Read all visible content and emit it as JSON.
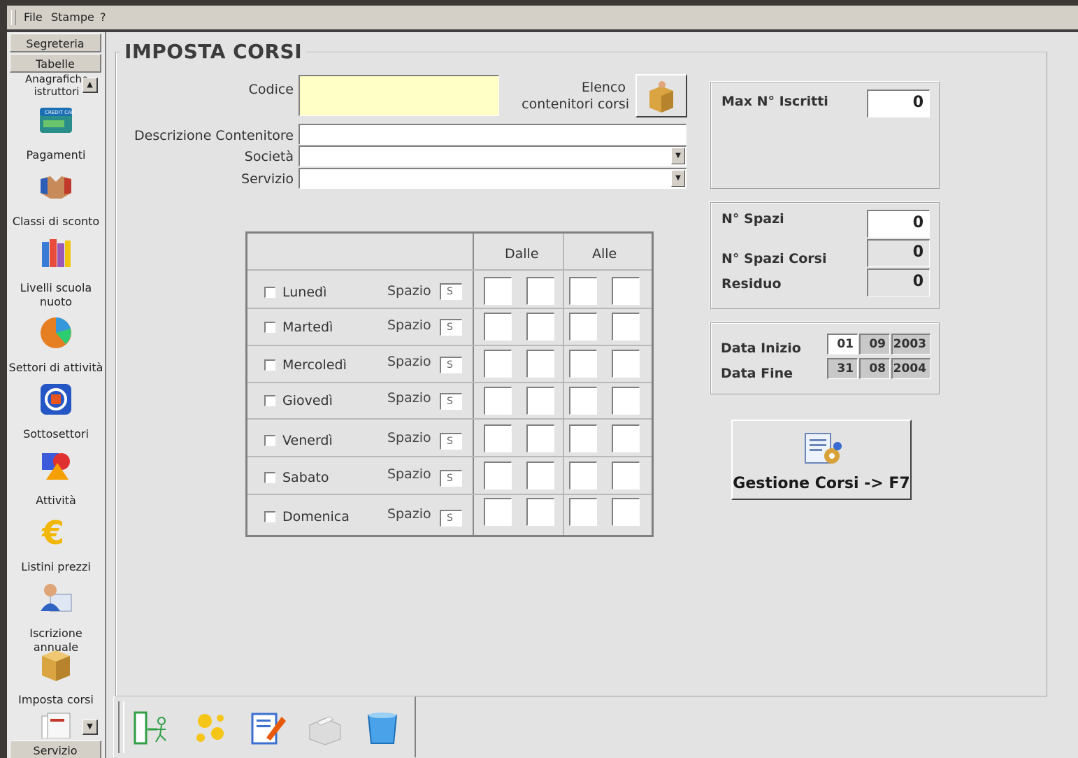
{
  "menubar": {
    "file": "File",
    "stampe": "Stampe",
    "help": "?"
  },
  "sidebar": {
    "segreteria": "Segreteria",
    "tabelle": "Tabelle",
    "servizio": "Servizio",
    "partial_item": "Anagrafiche istruttori",
    "items": [
      {
        "label": "Pagamenti",
        "icon": "credit-card-icon"
      },
      {
        "label": "Classi di sconto",
        "icon": "handshake-icon"
      },
      {
        "label": "Livelli scuola nuoto",
        "icon": "books-icon"
      },
      {
        "label": "Settori di attività",
        "icon": "pie-chart-icon"
      },
      {
        "label": "Sottosettori",
        "icon": "refresh-box-icon"
      },
      {
        "label": "Attività",
        "icon": "shapes-icon"
      },
      {
        "label": "Listini prezzi",
        "icon": "euro-icon"
      },
      {
        "label": "Iscrizione annuale",
        "icon": "user-card-icon"
      },
      {
        "label": "Imposta corsi",
        "icon": "box-icon"
      },
      {
        "label": "",
        "icon": "documents-icon"
      }
    ]
  },
  "form": {
    "title": "IMPOSTA CORSI",
    "codice_label": "Codice",
    "codice_value": "",
    "elenco_label_1": "Elenco",
    "elenco_label_2": "contenitori corsi",
    "descrizione_label": "Descrizione Contenitore",
    "societa_label": "Società",
    "servizio_label": "Servizio"
  },
  "schedule": {
    "dalle": "Dalle",
    "alle": "Alle",
    "spazio_label": "Spazio",
    "days": [
      {
        "name": "Lunedì",
        "spazio": "S"
      },
      {
        "name": "Martedì",
        "spazio": "S"
      },
      {
        "name": "Mercoledì",
        "spazio": "S"
      },
      {
        "name": "Giovedì",
        "spazio": "S"
      },
      {
        "name": "Venerdì",
        "spazio": "S"
      },
      {
        "name": "Sabato",
        "spazio": "S"
      },
      {
        "name": "Domenica",
        "spazio": "S"
      }
    ]
  },
  "iscritti": {
    "label": "Max N° Iscritti",
    "value": "0"
  },
  "spazi": {
    "spazi_label": "N° Spazi",
    "spazi_value": "0",
    "corsi_label": "N° Spazi Corsi",
    "corsi_value": "0",
    "residuo_label": "Residuo",
    "residuo_value": "0"
  },
  "dates": {
    "inizio_label": "Data Inizio",
    "inizio": [
      "01",
      "09",
      "2003"
    ],
    "fine_label": "Data Fine",
    "fine": [
      "31",
      "08",
      "2004"
    ]
  },
  "gestione_button": "Gestione Corsi -> F7",
  "toolbar": [
    "exit-icon",
    "new-sparkle-icon",
    "edit-icon",
    "print-icon",
    "delete-bin-icon"
  ]
}
